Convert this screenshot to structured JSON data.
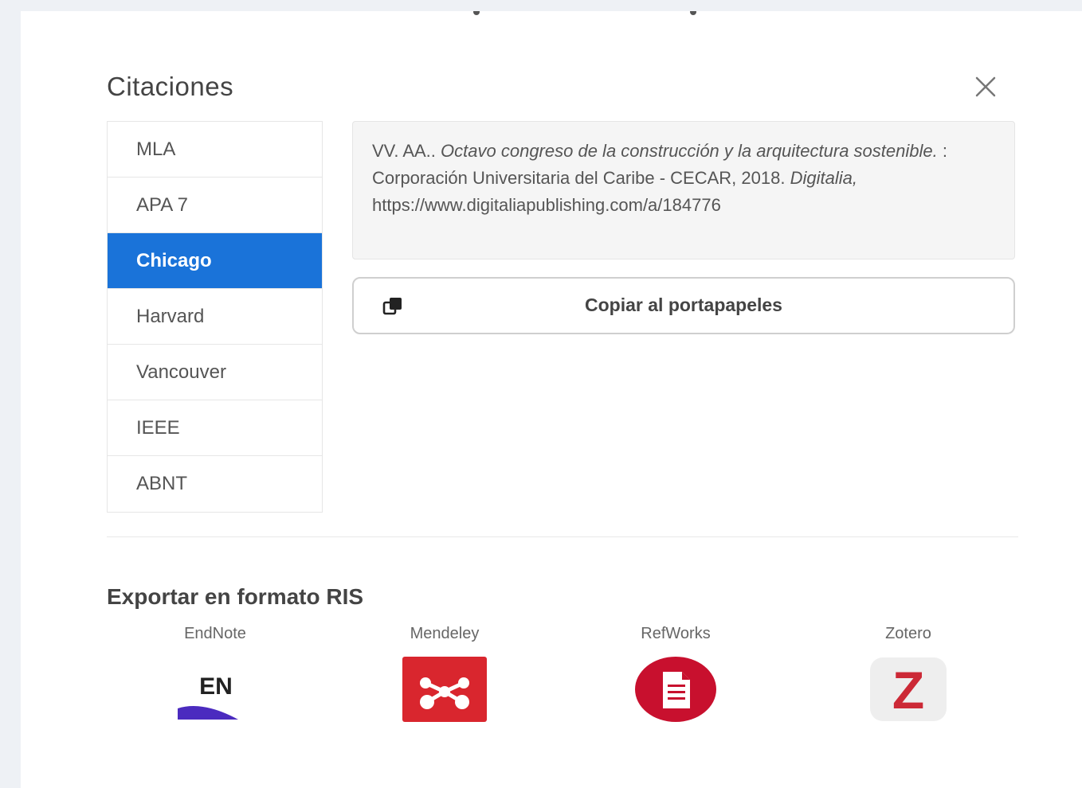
{
  "modal": {
    "title": "Citaciones",
    "close_icon": "close-icon"
  },
  "styles": [
    {
      "label": "MLA",
      "active": false
    },
    {
      "label": "APA 7",
      "active": false
    },
    {
      "label": "Chicago",
      "active": true
    },
    {
      "label": "Harvard",
      "active": false
    },
    {
      "label": "Vancouver",
      "active": false
    },
    {
      "label": "IEEE",
      "active": false
    },
    {
      "label": "ABNT",
      "active": false
    }
  ],
  "citation": {
    "authors": "VV. AA..",
    "title": "Octavo congreso de la construcción y la arquitectura sostenible.",
    "publisher": ": Corporación Universitaria del Caribe - CECAR, 2018.",
    "platform": "Digitalia,",
    "url": "https://www.digitaliapublishing.com/a/184776"
  },
  "copy_button": {
    "label": "Copiar al portapapeles",
    "icon": "copy-icon"
  },
  "export": {
    "title": "Exportar en formato RIS",
    "items": [
      {
        "label": "EndNote",
        "logo_text": "EN",
        "icon": "endnote-logo"
      },
      {
        "label": "Mendeley",
        "icon": "mendeley-logo"
      },
      {
        "label": "RefWorks",
        "icon": "refworks-logo"
      },
      {
        "label": "Zotero",
        "logo_text": "Z",
        "icon": "zotero-logo"
      }
    ]
  },
  "colors": {
    "accent": "#1a73d9",
    "mendeley": "#d9262e",
    "refworks": "#c8102e",
    "zotero": "#cc2936",
    "endnote_purple": "#4b2bbf"
  }
}
